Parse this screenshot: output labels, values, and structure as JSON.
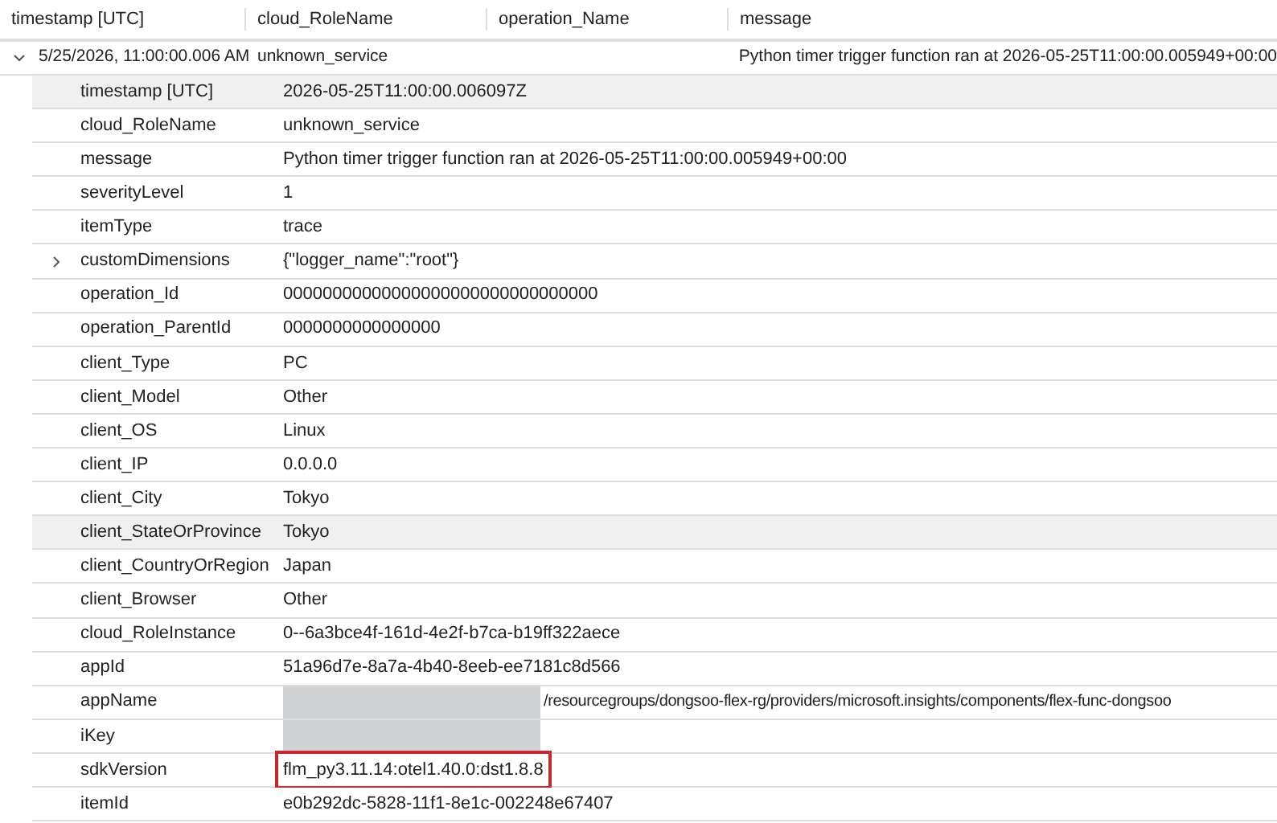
{
  "table": {
    "columns": [
      "timestamp [UTC]",
      "cloud_RoleName",
      "operation_Name",
      "message"
    ],
    "row": {
      "expanded": true,
      "timestamp": "5/25/2026, 11:00:00.006 AM",
      "cloud_RoleName": "unknown_service",
      "message": "Python timer trigger function ran at 2026-05-25T11:00:00.005949+00:00"
    },
    "details": [
      {
        "key": "timestamp [UTC]",
        "value": "2026-05-25T11:00:00.006097Z",
        "selected": true
      },
      {
        "key": "cloud_RoleName",
        "value": "unknown_service",
        "selected": false
      },
      {
        "key": "message",
        "value": "Python timer trigger function ran at 2026-05-25T11:00:00.005949+00:00",
        "selected": false
      },
      {
        "key": "severityLevel",
        "value": "1",
        "selected": false
      },
      {
        "key": "itemType",
        "value": "trace",
        "selected": false
      },
      {
        "key": "customDimensions",
        "value": "{\"logger_name\":\"root\"}",
        "selected": false,
        "expanded": false
      },
      {
        "key": "operation_Id",
        "value": "00000000000000000000000000000000",
        "selected": false
      },
      {
        "key": "operation_ParentId",
        "value": "0000000000000000",
        "selected": false
      },
      {
        "key": "client_Type",
        "value": "PC",
        "selected": false
      },
      {
        "key": "client_Model",
        "value": "Other",
        "selected": false
      },
      {
        "key": "client_OS",
        "value": "Linux",
        "selected": false
      },
      {
        "key": "client_IP",
        "value": "0.0.0.0",
        "selected": false
      },
      {
        "key": "client_City",
        "value": "Tokyo",
        "selected": false
      },
      {
        "key": "client_StateOrProvince",
        "value": "Tokyo",
        "selected": true
      },
      {
        "key": "client_CountryOrRegion",
        "value": "Japan",
        "selected": false
      },
      {
        "key": "client_Browser",
        "value": "Other",
        "selected": false
      },
      {
        "key": "cloud_RoleInstance",
        "value": "0--6a3bce4f-161d-4e2f-b7ca-b19ff322aece",
        "selected": false
      },
      {
        "key": "appId",
        "value": "51a96d7e-8a7a-4b40-8eeb-ee7181c8d566",
        "selected": false
      },
      {
        "key": "appName",
        "value": "/resourcegroups/dongsoo-flex-rg/providers/microsoft.insights/components/flex-func-dongsoo",
        "selected": false,
        "redacted": true
      },
      {
        "key": "iKey",
        "selected": false,
        "redacted": true
      },
      {
        "key": "sdkVersion",
        "value": "flm_py3.11.14:otel1.40.0:dst1.8.8",
        "selected": false,
        "highlighted": true
      },
      {
        "key": "itemId",
        "value": "e0b292dc-5828-11f1-8e1c-002248e67407",
        "selected": false
      }
    ]
  }
}
